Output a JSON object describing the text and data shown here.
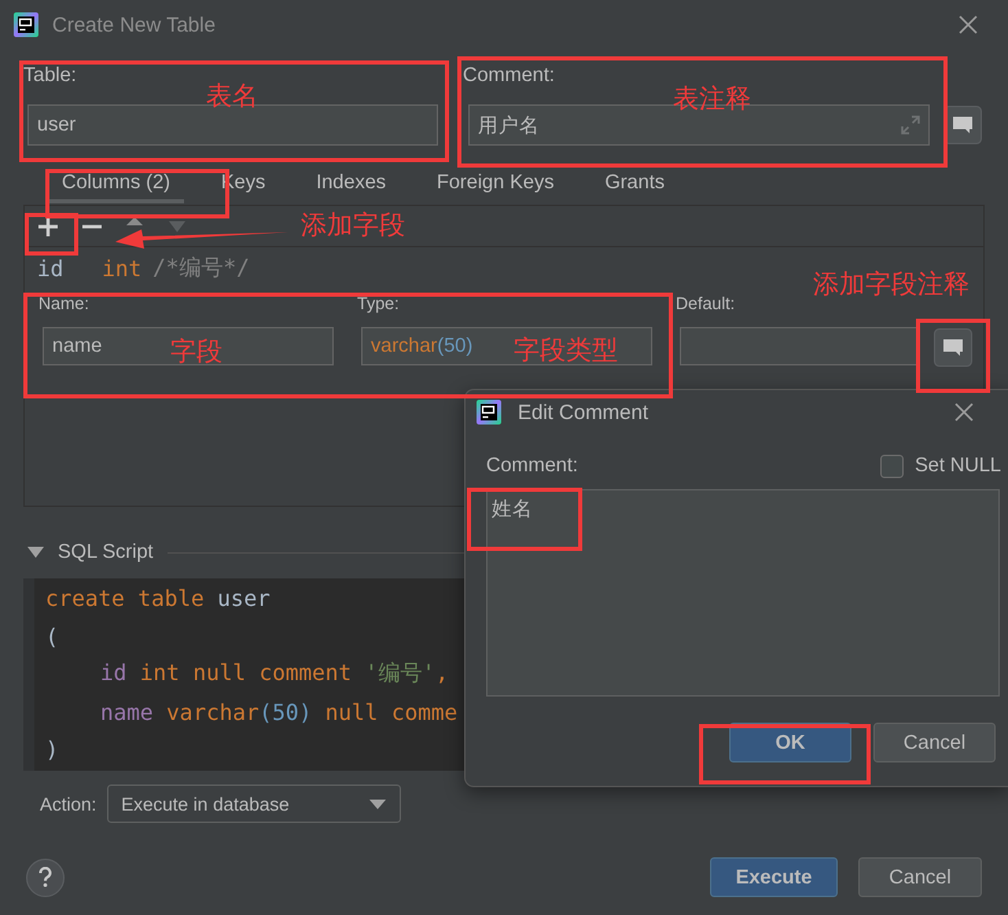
{
  "window": {
    "title": "Create New Table"
  },
  "table_field": {
    "label": "Table:",
    "value": "user"
  },
  "comment_field": {
    "label": "Comment:",
    "value": "用户名"
  },
  "tabs": [
    {
      "label": "Columns (2)",
      "selected": true
    },
    {
      "label": "Keys",
      "selected": false
    },
    {
      "label": "Indexes",
      "selected": false
    },
    {
      "label": "Foreign Keys",
      "selected": false
    },
    {
      "label": "Grants",
      "selected": false
    }
  ],
  "columns": [
    {
      "name": "id",
      "type": "int",
      "comment": "/*编号*/"
    }
  ],
  "column_editor": {
    "name_label": "Name:",
    "name": "name",
    "type_label": "Type:",
    "type": "varchar",
    "size": "(50)",
    "default_label": "Default:"
  },
  "sql_script": {
    "title": "SQL Script",
    "expanded": true,
    "lines": [
      {
        "indented": false,
        "tokens": [
          {
            "kind": "keyword",
            "text": "create table "
          },
          {
            "kind": "plain",
            "text": "user"
          }
        ]
      },
      {
        "indented": false,
        "tokens": [
          {
            "kind": "plain",
            "text": "("
          }
        ]
      },
      {
        "indented": true,
        "tokens": [
          {
            "kind": "ident",
            "text": "id "
          },
          {
            "kind": "keyword",
            "text": "int null comment "
          },
          {
            "kind": "string",
            "text": "'编号'"
          },
          {
            "kind": "keyword",
            "text": ","
          }
        ]
      },
      {
        "indented": true,
        "tokens": [
          {
            "kind": "ident",
            "text": "name "
          },
          {
            "kind": "keyword",
            "text": "varchar"
          },
          {
            "kind": "number",
            "text": "(50)"
          },
          {
            "kind": "keyword",
            "text": " null comme"
          }
        ]
      },
      {
        "indented": false,
        "tokens": [
          {
            "kind": "plain",
            "text": ")"
          }
        ]
      }
    ]
  },
  "action": {
    "label": "Action:",
    "value": "Execute in database"
  },
  "buttons": [
    {
      "label": "Execute",
      "primary": true
    },
    {
      "label": "Cancel",
      "primary": false
    }
  ],
  "edit_comment": {
    "title": "Edit Comment",
    "label": "Comment:",
    "set_null": {
      "label": "Set NULL",
      "checked": false
    },
    "value": "姓名",
    "buttons": [
      {
        "label": "OK",
        "primary": true
      },
      {
        "label": "Cancel",
        "primary": false
      }
    ]
  },
  "annotations": [
    {
      "text": "表名"
    },
    {
      "text": "表注释"
    },
    {
      "text": "添加字段"
    },
    {
      "text": "字段"
    },
    {
      "text": "字段类型"
    },
    {
      "text": "添加字段注释"
    }
  ]
}
